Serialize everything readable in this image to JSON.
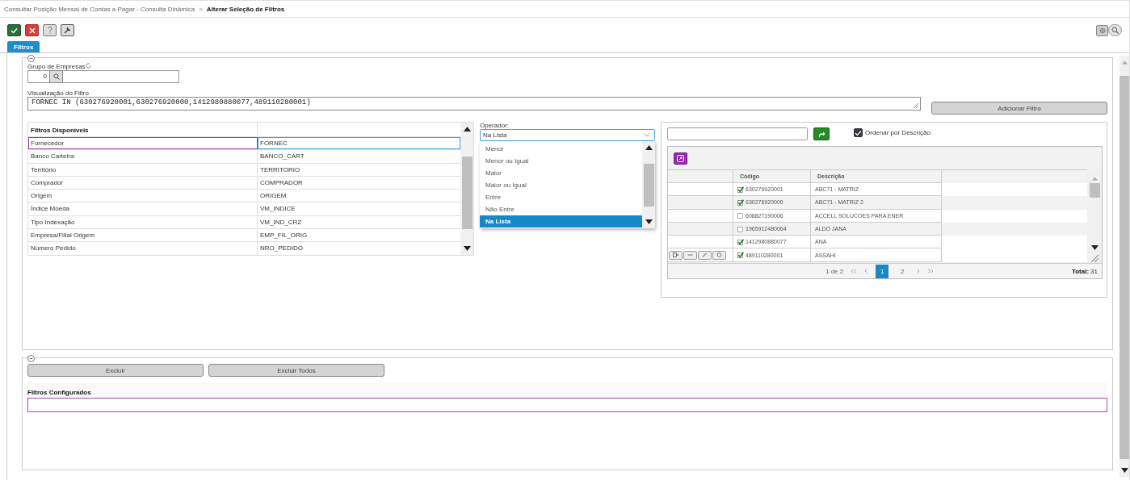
{
  "breadcrumb": {
    "path": "Consultar Posição Mensal de Contas a Pagar - Consulta Dinâmica",
    "separator": ">",
    "current": "Alterar Seleção de Filtros"
  },
  "toolbar": [
    {
      "kind": "confirm"
    },
    {
      "kind": "cancel"
    },
    {
      "kind": "help"
    },
    {
      "kind": "tools"
    }
  ],
  "tabs": [
    {
      "label": "Filtros",
      "selected": true
    }
  ],
  "company_group": {
    "label": "Grupo de Empresas",
    "code": "0"
  },
  "filter_preview": {
    "label": "Visualização do Filtro",
    "value": "FORNEC IN (630276920001,630276920000,1412980880077,489110280001)"
  },
  "add_button": "Adicionar Filtro",
  "available_filters": {
    "header": "Filtros Disponíveis",
    "rows": [
      {
        "name": "Fornecedor",
        "code": "FORNEC",
        "selected": true
      },
      {
        "name": "Banco Carteira",
        "code": "BANCO_CART",
        "selected": false
      },
      {
        "name": "Território",
        "code": "TERRITORIO",
        "selected": false
      },
      {
        "name": "Comprador",
        "code": "COMPRADOR",
        "selected": false
      },
      {
        "name": "Origem",
        "code": "ORIGEM",
        "selected": false
      },
      {
        "name": "Índice Moeda",
        "code": "VM_INDICE",
        "selected": false
      },
      {
        "name": "Tipo Indexação",
        "code": "VM_IND_CRZ",
        "selected": false
      },
      {
        "name": "Empresa/Filial Origem",
        "code": "EMP_FIL_ORIG",
        "selected": false
      },
      {
        "name": "Número Pedido",
        "code": "NRO_PEDIDO",
        "selected": false
      }
    ]
  },
  "operator": {
    "label": "Operador:",
    "value": "Na Lista",
    "options": [
      {
        "label": "Menor",
        "selected": false
      },
      {
        "label": "Menor ou Igual",
        "selected": false
      },
      {
        "label": "Maior",
        "selected": false
      },
      {
        "label": "Maior ou Igual",
        "selected": false
      },
      {
        "label": "Entre",
        "selected": false
      },
      {
        "label": "Não Entre",
        "selected": false
      },
      {
        "label": "Na Lista",
        "selected": true
      }
    ]
  },
  "value_picker": {
    "order_by": {
      "label": "Ordenar por Descrição",
      "checked": true
    },
    "columns": [
      "Código",
      "Descrição"
    ],
    "rows": [
      {
        "code": "630276920001",
        "description": "ABC71 - MATRIZ",
        "checked": true,
        "selected": false
      },
      {
        "code": "630276920000",
        "description": "ABC71 - MATRIZ 2",
        "checked": true,
        "selected": false
      },
      {
        "code": "608827190006",
        "description": "ACCELL SOLUCOES PARA ENER",
        "checked": false,
        "selected": false
      },
      {
        "code": "1965912480064",
        "description": "ALDO JANA",
        "checked": false,
        "selected": false
      },
      {
        "code": "1412980880077",
        "description": "ANA",
        "checked": true,
        "selected": false
      },
      {
        "code": "489110280001",
        "description": "ASSAHI",
        "checked": true,
        "selected": true
      }
    ],
    "pagination": {
      "summary": "1 de 2",
      "pages": [
        {
          "label": "1",
          "selected": true
        },
        {
          "label": "2",
          "selected": false
        }
      ],
      "total_label": "Total:",
      "total": "31"
    }
  },
  "delete_buttons": [
    "Excluir",
    "Excluir Todos"
  ],
  "configured_filters": {
    "label": "Filtros Configurados"
  }
}
